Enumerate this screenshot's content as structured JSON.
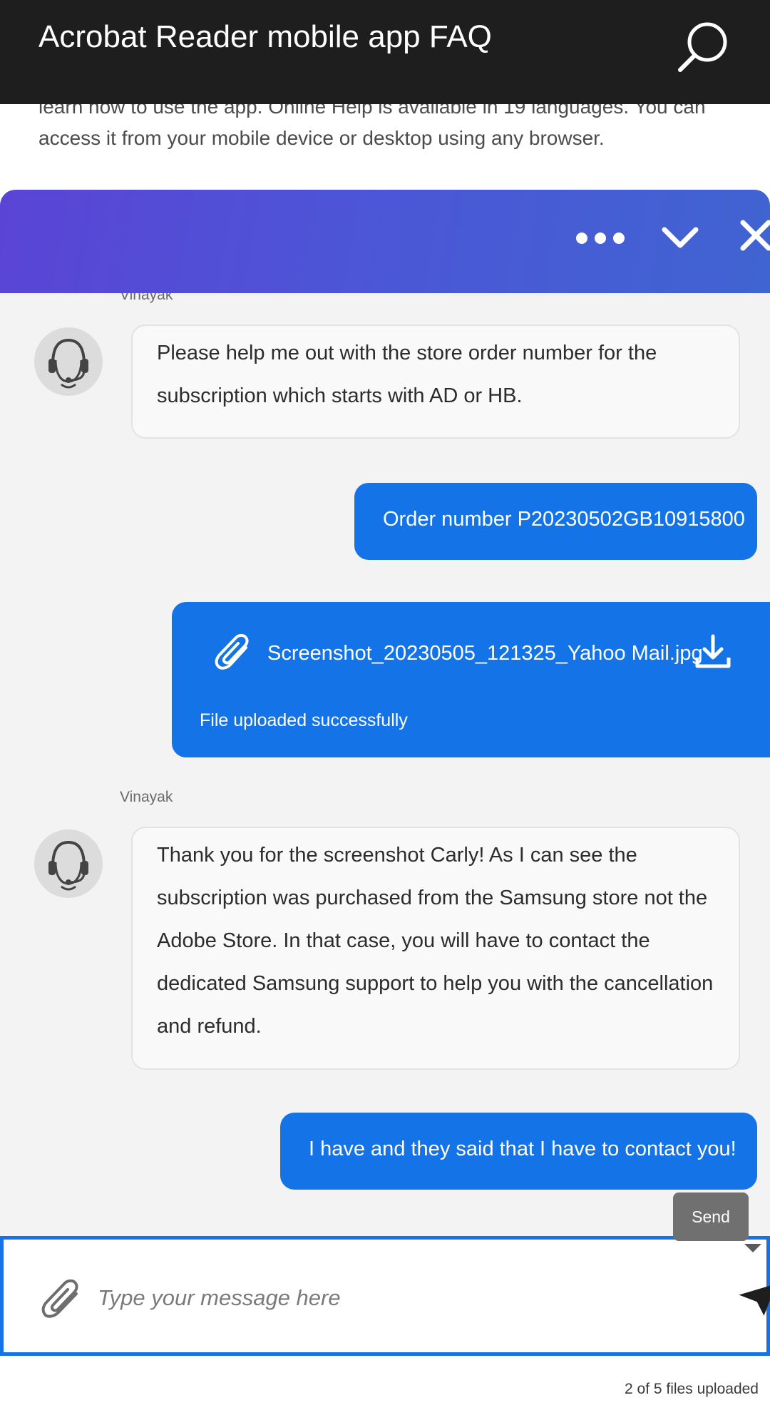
{
  "header": {
    "title": "Acrobat Reader mobile app FAQ",
    "search_icon": "search-icon"
  },
  "article": {
    "text": "learn how to use the app. Online Help is available in 19 languages. You can access it from your mobile device or desktop using any browser."
  },
  "chat": {
    "header_icons": [
      "more-options-icon",
      "chevron-down-icon",
      "close-icon"
    ],
    "theme": {
      "user_bubble": "#1473e6",
      "header_start": "#5a44d6",
      "header_end": "#4064d2"
    },
    "messages": [
      {
        "sender": "Vinayak",
        "type": "agent",
        "text": "Please help me out with the store order number for the subscription which starts with AD or HB."
      },
      {
        "type": "user",
        "text": "Order number P20230502GB10915800"
      },
      {
        "type": "file",
        "filename": "Screenshot_20230505_121325_Yahoo Mail.jpg",
        "status": "File uploaded successfully"
      },
      {
        "sender": "Vinayak",
        "type": "agent",
        "text": "Thank you for the screenshot Carly! As I can see the subscription was purchased from the Samsung store not the Adobe Store. In that case, you will have to contact the dedicated Samsung support to help you with the cancellation and refund."
      },
      {
        "type": "user",
        "text": "I have and they said that I have to contact you!"
      }
    ],
    "send_tooltip": "Send",
    "composer": {
      "placeholder": "Type your message here",
      "value": ""
    },
    "files_uploaded": "2 of 5 files uploaded"
  }
}
